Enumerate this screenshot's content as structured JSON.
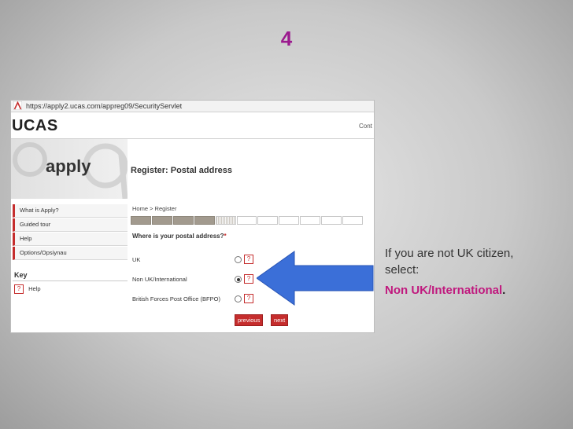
{
  "slide": {
    "number": "4"
  },
  "screenshot": {
    "url": "https://apply2.ucas.com/appreg09/SecurityServlet",
    "logo": "UCAS",
    "cont_text": "Cont",
    "apply_word": "apply",
    "page_title": "Register: Postal address",
    "breadcrumb": "Home > Register",
    "nav_items": [
      "What is Apply?",
      "Guided tour",
      "Help",
      "Options/Opsiynau"
    ],
    "key": {
      "title": "Key",
      "help_label": "Help",
      "help_icon_text": "?"
    },
    "progress": {
      "total_steps": 11,
      "completed_steps": 4,
      "current_step": 5
    },
    "question": {
      "text": "Where is your postal address?",
      "required_marker": "*"
    },
    "options": [
      {
        "label": "UK",
        "selected": false
      },
      {
        "label": "Non UK/International",
        "selected": true
      },
      {
        "label": "British Forces Post Office (BFPO)",
        "selected": false
      }
    ],
    "buttons": {
      "previous": "previous",
      "next": "next"
    }
  },
  "callout": {
    "line1": "If you are not UK citizen,",
    "line2": "select:",
    "highlight": "Non UK/International",
    "end": "."
  },
  "colors": {
    "slide_number": "#9b1a8e",
    "highlight": "#c0197e",
    "arrow": "#3b6fd8",
    "ucas_red": "#c52d2d",
    "progress_done": "#a29a8e"
  }
}
